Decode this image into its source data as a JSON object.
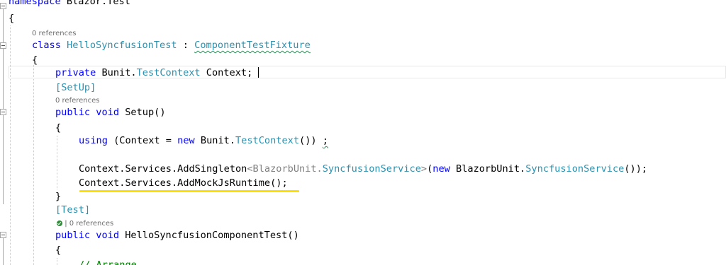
{
  "code": {
    "ns_keyword": "namespace",
    "ns_name": " Blazor.Test",
    "open_brace": "{",
    "close_brace": "}",
    "class_keyword": "class",
    "class_name": "HelloSyncfusionTest",
    "colon": " : ",
    "base_type": "ComponentTestFixture",
    "private_kw": "private",
    "bunit_ns": "Bunit.",
    "test_context": "TestContext",
    "field_tail": " Context;",
    "setup_attr_open": "[",
    "setup_attr": "SetUp",
    "attr_close": "]",
    "public_kw": "public",
    "void_kw": "void",
    "setup_sig": "Setup()",
    "using_kw": "using",
    "using_mid": " (Context = ",
    "new_kw": "new",
    "bunit_ns2": " Bunit.",
    "using_tail": "()) ",
    "using_semicolon": ";",
    "services_prefix": "Context.Services.AddSingleton",
    "generic_open": "<BlazorbUnit.",
    "syncfusion_service": "SyncfusionService",
    "generic_close": ">",
    "paren_open": "(",
    "blazorb_ns": " BlazorbUnit.",
    "singleton_tail": "());",
    "mock_runtime": "Context.Services.AddMockJsRuntime();",
    "test_attr": "Test",
    "test_sig": "HelloSyncfusionComponentTest()",
    "comment_partial": "// Arrange"
  },
  "codelens": {
    "class_refs": "0 references",
    "setup_refs": "0 references",
    "test_refs": "| 0 references"
  },
  "colors": {
    "keyword": "#0000ff",
    "type": "#2b91af",
    "comment": "#008000",
    "highlight_underline": "#ffe100"
  }
}
